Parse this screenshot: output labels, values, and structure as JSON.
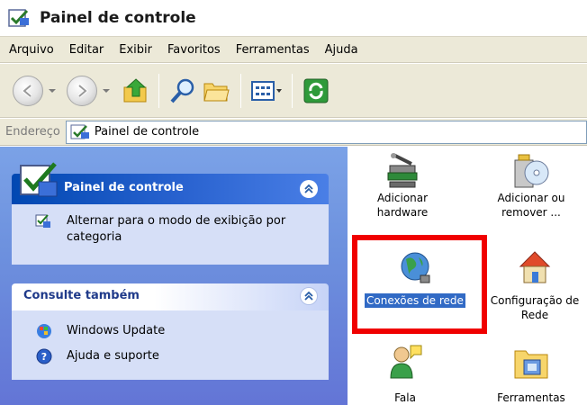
{
  "window": {
    "title": "Painel de controle"
  },
  "menu": [
    "Arquivo",
    "Editar",
    "Exibir",
    "Favoritos",
    "Ferramentas",
    "Ajuda"
  ],
  "address": {
    "label": "Endereço",
    "value": "Painel de controle"
  },
  "left_panel": {
    "task_box": {
      "title": "Painel de controle",
      "link_line1": "Alternar para o modo de exibição por",
      "link_line2": "categoria"
    },
    "see_also": {
      "title": "Consulte também",
      "items": [
        "Windows Update",
        "Ajuda e suporte"
      ]
    }
  },
  "items": [
    {
      "line1": "Adicionar",
      "line2": "hardware"
    },
    {
      "line1": "Adicionar ou",
      "line2": "remover ..."
    },
    {
      "line1": "Conexões de rede"
    },
    {
      "line1": "Configuração de",
      "line2": "Rede"
    },
    {
      "line1": "Fala"
    },
    {
      "line1": "Ferramentas"
    }
  ],
  "highlight_color": "#f00000"
}
